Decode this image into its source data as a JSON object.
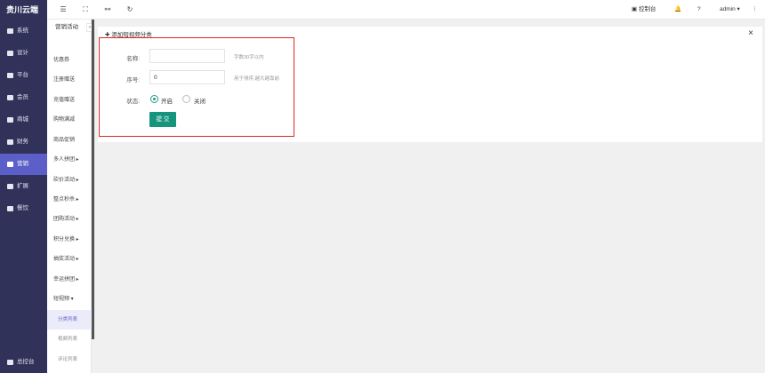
{
  "brand": "贵川云端",
  "main_nav": [
    {
      "label": "系统",
      "icon": "monitor-icon"
    },
    {
      "label": "设计",
      "icon": "design-icon"
    },
    {
      "label": "平台",
      "icon": "grid-icon"
    },
    {
      "label": "会员",
      "icon": "heart-icon"
    },
    {
      "label": "商城",
      "icon": "shop-icon"
    },
    {
      "label": "财务",
      "icon": "wallet-icon"
    },
    {
      "label": "营销",
      "icon": "megaphone-icon",
      "active": true
    },
    {
      "label": "扩展",
      "icon": "gear-icon"
    },
    {
      "label": "餐饮",
      "icon": "cloud-icon"
    }
  ],
  "console_bottom": "总控台",
  "sub_nav": {
    "title": "营销活动",
    "collapse": "«",
    "items": [
      "优惠券",
      "注册赠送",
      "充值赠送",
      "购物满减",
      "商品促销",
      "多人拼团 ▸",
      "砍价活动 ▸",
      "整点秒杀 ▸",
      "团购活动 ▸",
      "积分兑换 ▸",
      "抽奖活动 ▸",
      "幸运拼团 ▸",
      "短视频 ▾"
    ],
    "sub_items": [
      "分类列表",
      "视频列表",
      "评论列表"
    ]
  },
  "topbar": {
    "icons": [
      "menu-icon",
      "fullscreen-icon",
      "link-icon",
      "refresh-icon"
    ],
    "console": "控制台",
    "user": "admin ▾",
    "more": "⋮"
  },
  "tab": {
    "title": "✚ 添加短视频分类",
    "close": "×"
  },
  "form": {
    "name_label": "名称:",
    "name_value": "",
    "name_hint": "字数30字以内",
    "sort_label": "序号:",
    "sort_value": "0",
    "sort_hint": "用于排序,越大越靠前",
    "status_label": "状态:",
    "status_on": "开启",
    "status_off": "关闭",
    "submit": "提 交"
  },
  "colors": {
    "sidebar": "#30325a",
    "active": "#5b5fc7",
    "primary": "#15947e",
    "highlight": "#d9281e"
  }
}
